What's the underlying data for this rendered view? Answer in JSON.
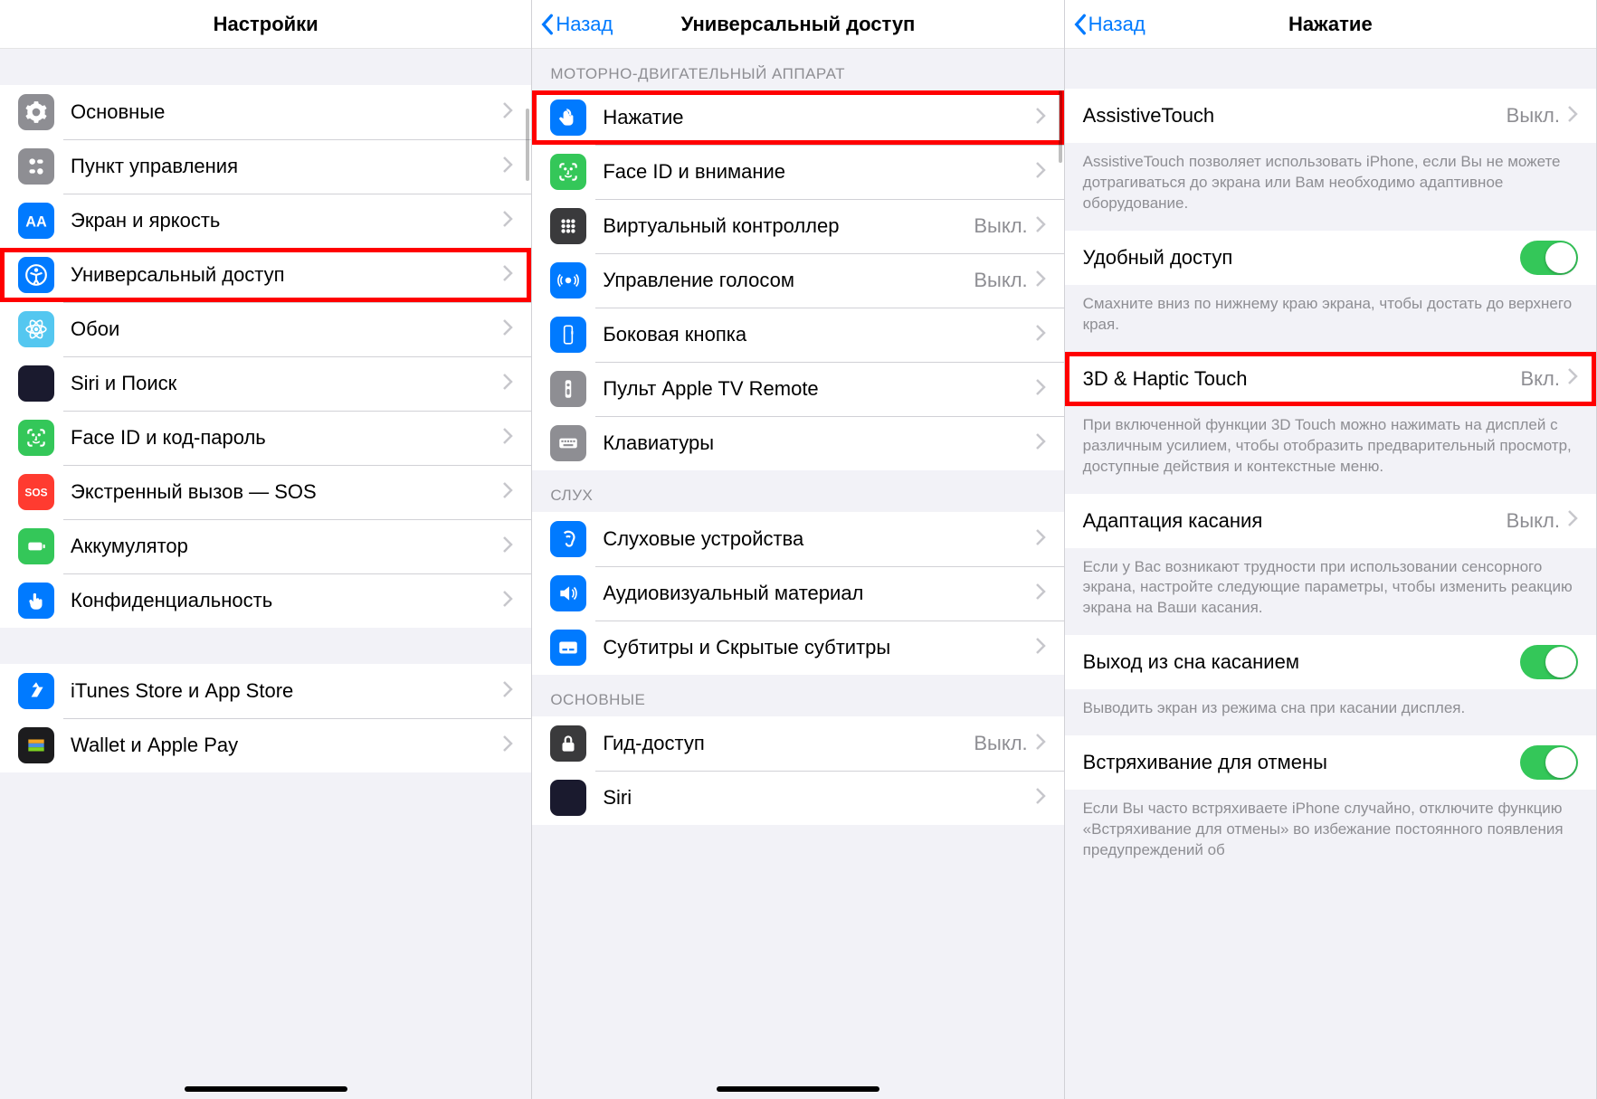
{
  "panel1": {
    "title": "Настройки",
    "items": [
      {
        "label": "Основные",
        "icon": "gear",
        "color": "#8e8e93"
      },
      {
        "label": "Пункт управления",
        "icon": "control",
        "color": "#8e8e93"
      },
      {
        "label": "Экран и яркость",
        "icon": "display",
        "color": "#007aff"
      },
      {
        "label": "Универсальный доступ",
        "icon": "accessibility",
        "color": "#007aff",
        "highlight": true
      },
      {
        "label": "Обои",
        "icon": "wallpaper",
        "color": "#54c7f0"
      },
      {
        "label": "Siri и Поиск",
        "icon": "siri",
        "color": "#1a1a2e"
      },
      {
        "label": "Face ID и код-пароль",
        "icon": "faceid",
        "color": "#34c759"
      },
      {
        "label": "Экстренный вызов — SOS",
        "icon": "sos",
        "color": "#ff3b30"
      },
      {
        "label": "Аккумулятор",
        "icon": "battery",
        "color": "#34c759"
      },
      {
        "label": "Конфиденциальность",
        "icon": "privacy",
        "color": "#007aff"
      }
    ],
    "items2": [
      {
        "label": "iTunes Store и App Store",
        "icon": "appstore",
        "color": "#007aff"
      },
      {
        "label": "Wallet и Apple Pay",
        "icon": "wallet",
        "color": "#1c1c1e"
      }
    ]
  },
  "panel2": {
    "back": "Назад",
    "title": "Универсальный доступ",
    "section1_header": "Моторно-двигательный аппарат",
    "section1": [
      {
        "label": "Нажатие",
        "icon": "touch",
        "color": "#007aff",
        "highlight": true
      },
      {
        "label": "Face ID и внимание",
        "icon": "faceid2",
        "color": "#34c759"
      },
      {
        "label": "Виртуальный контроллер",
        "icon": "switch",
        "color": "#3a3a3c",
        "detail": "Выкл."
      },
      {
        "label": "Управление голосом",
        "icon": "voice",
        "color": "#007aff",
        "detail": "Выкл."
      },
      {
        "label": "Боковая кнопка",
        "icon": "sidebutton",
        "color": "#007aff"
      },
      {
        "label": "Пульт Apple TV Remote",
        "icon": "remote",
        "color": "#8e8e93"
      },
      {
        "label": "Клавиатуры",
        "icon": "keyboard",
        "color": "#8e8e93"
      }
    ],
    "section2_header": "Слух",
    "section2": [
      {
        "label": "Слуховые устройства",
        "icon": "hearing",
        "color": "#007aff"
      },
      {
        "label": "Аудиовизуальный материал",
        "icon": "audio",
        "color": "#007aff"
      },
      {
        "label": "Субтитры и Скрытые субтитры",
        "icon": "subtitles",
        "color": "#007aff"
      }
    ],
    "section3_header": "Основные",
    "section3": [
      {
        "label": "Гид-доступ",
        "icon": "guided",
        "color": "#3a3a3c",
        "detail": "Выкл."
      },
      {
        "label": "Siri",
        "icon": "siri2",
        "color": "#1a1a2e"
      }
    ]
  },
  "panel3": {
    "back": "Назад",
    "title": "Нажатие",
    "rows": [
      {
        "label": "AssistiveTouch",
        "detail": "Выкл.",
        "chevron": true
      },
      {
        "footer": "AssistiveTouch позволяет использовать iPhone, если Вы не можете дотрагиваться до экрана или Вам необходимо адаптивное оборудование."
      },
      {
        "label": "Удобный доступ",
        "toggle": "on"
      },
      {
        "footer": "Смахните вниз по нижнему краю экрана, чтобы достать до верхнего края."
      },
      {
        "label": "3D & Haptic Touch",
        "detail": "Вкл.",
        "chevron": true,
        "highlight": true
      },
      {
        "footer": "При включенной функции 3D Touch можно нажимать на дисплей с различным усилием, чтобы отобразить предварительный просмотр, доступные действия и контекстные меню."
      },
      {
        "label": "Адаптация касания",
        "detail": "Выкл.",
        "chevron": true
      },
      {
        "footer": "Если у Вас возникают трудности при использовании сенсорного экрана, настройте следующие параметры, чтобы изменить реакцию экрана на Ваши касания."
      },
      {
        "label": "Выход из сна касанием",
        "toggle": "on"
      },
      {
        "footer": "Выводить экран из режима сна при касании дисплея."
      },
      {
        "label": "Встряхивание для отмены",
        "toggle": "on"
      },
      {
        "footer": "Если Вы часто встряхиваете iPhone случайно, отключите функцию «Встряхивание для отмены» во избежание постоянного появления предупреждений об"
      }
    ]
  }
}
